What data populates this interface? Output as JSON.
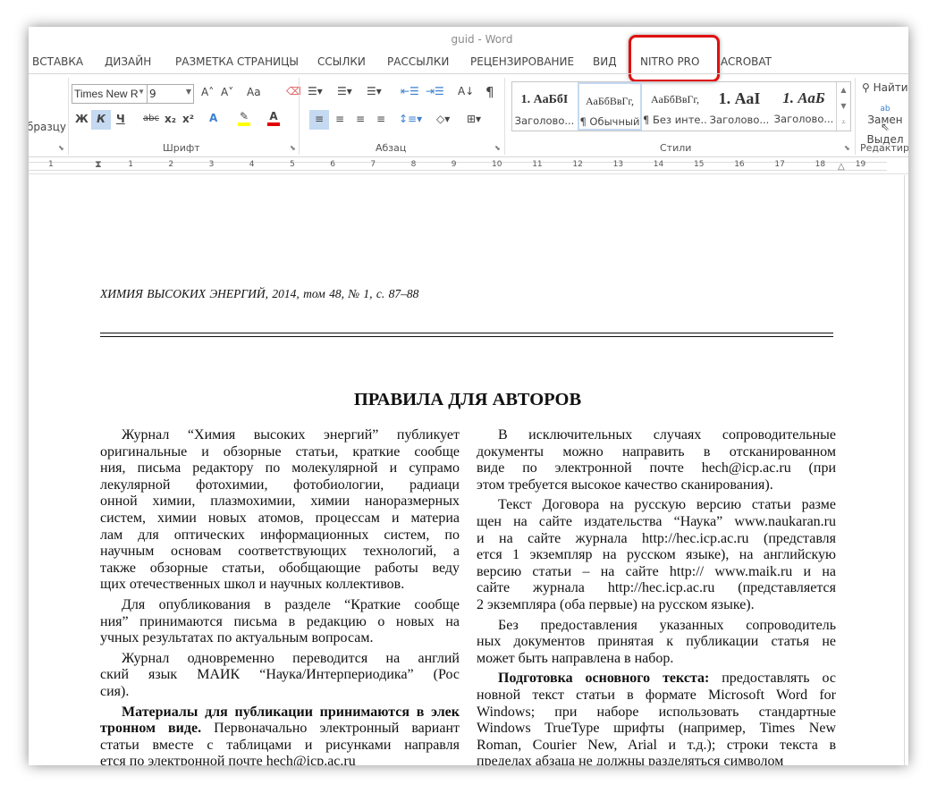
{
  "window": {
    "title": "guid - Word"
  },
  "tabs": [
    "ВСТАВКА",
    "ДИЗАЙН",
    "РАЗМЕТКА СТРАНИЦЫ",
    "ССЫЛКИ",
    "РАССЫЛКИ",
    "РЕЦЕНЗИРОВАНИЕ",
    "ВИД",
    "NITRO PRO",
    "ACROBAT"
  ],
  "highlighted_tab": "NITRO PRO",
  "ribbon": {
    "clipboard_partial": "бразцу",
    "font": {
      "name": "Times New R",
      "size": "9",
      "label": "Шрифт",
      "bold": "Ж",
      "italic": "К",
      "underline": "Ч",
      "strike": "abc",
      "sub": "x₂",
      "sup": "x²",
      "grow": "A˄",
      "shrink": "A˅",
      "case": "Aa",
      "color_a": "A",
      "highlight_color": "#ffff00",
      "font_color": "#e00000"
    },
    "paragraph": {
      "label": "Абзац",
      "pilcrow": "¶"
    },
    "styles": {
      "label": "Стили",
      "items": [
        {
          "preview": "1.  АаБбI",
          "name": "Заголово..."
        },
        {
          "preview": "АаБбВвГг,",
          "name": "¶ Обычный",
          "selected": true
        },
        {
          "preview": "АаБбВвГг,",
          "name": "¶ Без инте..."
        },
        {
          "preview": "1.  АаI",
          "name": "Заголово..."
        },
        {
          "preview": "1.  АаБ",
          "name": "Заголово..."
        }
      ]
    },
    "editing": {
      "label": "Редактиро",
      "find": "Найти",
      "replace": "Замен",
      "select": "Выдел"
    }
  },
  "ruler": {
    "numbers": [
      "1",
      "1",
      "2",
      "3",
      "4",
      "5",
      "6",
      "7",
      "8",
      "9",
      "10",
      "11",
      "12",
      "13",
      "14",
      "15",
      "16",
      "17",
      "18",
      "19"
    ]
  },
  "document": {
    "journal_line": "ХИМИЯ  ВЫСОКИХ  ЭНЕРГИЙ,  2014,  том 48,  № 1,  с.  87–88",
    "heading": "ПРАВИЛА ДЛЯ АВТОРОВ",
    "col1": [
      [
        "Журнал “Химия высоких энергий” публикует",
        "оригинальные и обзорные статьи, краткие сообще",
        "ния, письма редактору по молекулярной и супрамо",
        "лекулярной фотохимии, фотобиологии, радиаци",
        "онной химии, плазмохимии, химии наноразмерных",
        "систем, химии новых атомов, процессам и материа",
        "лам для оптических информационных систем, по",
        "научным основам соответствующих технологий, а",
        "также обзорные статьи, обобщающие работы веду",
        "щих отечественных школ и научных коллективов."
      ],
      [
        "Для опубликования в разделе “Краткие сообще",
        "ния” принимаются письма в редакцию о новых на",
        "учных результатах по актуальным вопросам."
      ],
      [
        "Журнал одновременно переводится на англий",
        "ский язык МАИК “Наука/Интерпериодика” (Рос",
        "сия)."
      ],
      [
        {
          "b": "Материалы для публикации принимаются в элек"
        },
        {
          "b": "тронном виде.",
          "t": " Первоначально электронный вариант"
        },
        "статьи вместе с таблицами и рисунками направля",
        "ется по электронной почте hech@icp.ac.ru"
      ]
    ],
    "col2": [
      [
        "В исключительных случаях сопроводительные",
        "документы можно направить в отсканированном",
        "виде по электронной почте hech@icp.ac.ru (при",
        "этом требуется высокое качество сканирования)."
      ],
      [
        "Текст Договора на русскую версию статьи разме",
        "щен на сайте издательства “Наука” www.naukaran.ru",
        "и на сайте журнала http://hec.icp.ac.ru (представля",
        "ется 1 экземпляр на русском языке), на английскую",
        "версию статьи – на сайте http:// www.maik.ru и на",
        "сайте журнала http://hec.icp.ac.ru (представляется",
        "2 экземпляра (оба первые) на русском языке)."
      ],
      [
        "Без предоставления указанных сопроводитель",
        "ных документов принятая к публикации статья не",
        "может быть направлена в набор."
      ],
      [
        {
          "b": "Подготовка основного текста:",
          "t": " предоставлять ос"
        },
        "новной текст статьи в формате Microsoft Word for",
        "Windows; при наборе использовать стандартные",
        "Windows TrueType шрифты (например, Times New",
        "Roman, Courier New, Arial и т.д.); строки текста в",
        "пределах абзаца не должны разделяться символом"
      ]
    ]
  }
}
